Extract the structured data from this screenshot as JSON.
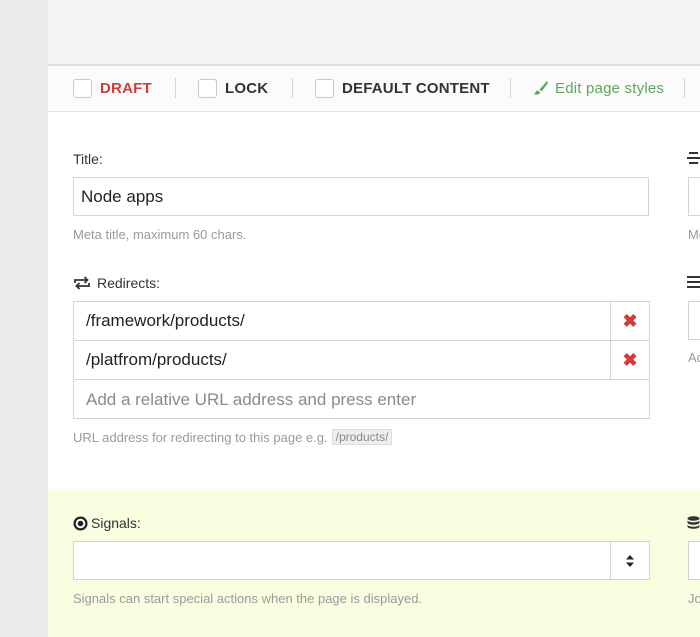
{
  "toolbar": {
    "draft_label": "DRAFT",
    "lock_label": "LOCK",
    "default_content_label": "DEFAULT CONTENT",
    "edit_styles_label": "Edit page styles"
  },
  "title_field": {
    "label": "Title:",
    "value": "Node apps",
    "help": "Meta title, maximum 60 chars."
  },
  "redirects": {
    "label": "Redirects:",
    "items": [
      "/framework/products/",
      "/platfrom/products/"
    ],
    "placeholder": "Add a relative URL address and press enter",
    "help": "URL address for redirecting to this page e.g.",
    "help_example": "/products/"
  },
  "signals": {
    "label": "Signals:",
    "value": "",
    "help": "Signals can start special actions when the page is displayed."
  },
  "right_column": {
    "help_1": "Me",
    "help_2": "Ac",
    "help_3": "Jo"
  },
  "colors": {
    "accent_red": "#d33a3a",
    "accent_green": "#5aa95a",
    "signals_bg": "#fbfde0"
  }
}
